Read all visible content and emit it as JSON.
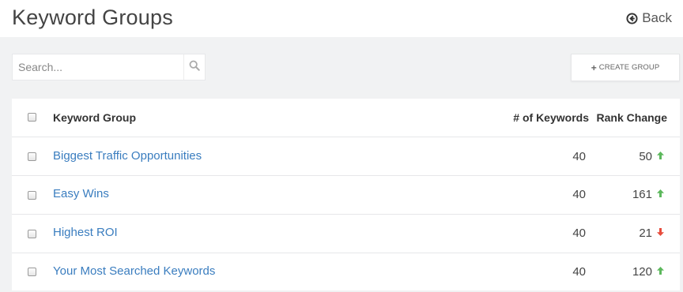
{
  "header": {
    "title": "Keyword Groups",
    "back_label": "Back"
  },
  "search": {
    "placeholder": "Search...",
    "value": ""
  },
  "toolbar": {
    "create_label": "CREATE GROUP"
  },
  "table": {
    "columns": {
      "group": "Keyword Group",
      "keywords": "# of Keywords",
      "rank_change": "Rank Change"
    },
    "rows": [
      {
        "name": "Biggest Traffic Opportunities",
        "keywords": "40",
        "rank_change": "50",
        "direction": "up"
      },
      {
        "name": "Easy Wins",
        "keywords": "40",
        "rank_change": "161",
        "direction": "up"
      },
      {
        "name": "Highest ROI",
        "keywords": "40",
        "rank_change": "21",
        "direction": "down"
      },
      {
        "name": "Your Most Searched Keywords",
        "keywords": "40",
        "rank_change": "120",
        "direction": "up"
      }
    ]
  },
  "colors": {
    "up": "#5cb85c",
    "down": "#e74c3c",
    "link": "#3a7dbf"
  },
  "icons": {
    "back": "circle-arrow-left-icon",
    "search": "search-icon",
    "create": "plus-icon",
    "up": "arrow-up-icon",
    "down": "arrow-down-icon"
  }
}
